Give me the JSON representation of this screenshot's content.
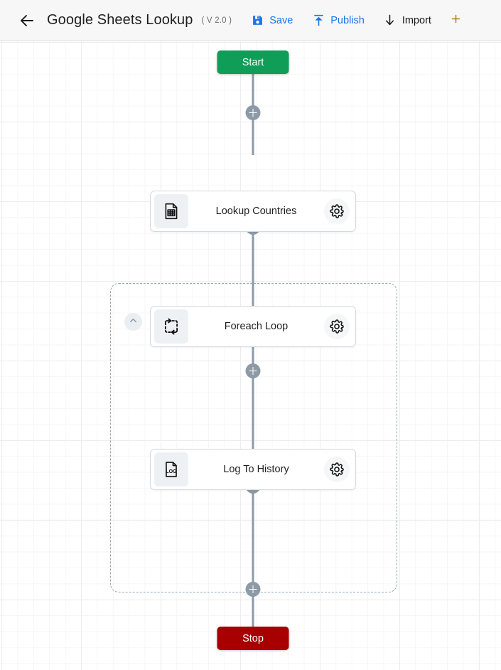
{
  "header": {
    "back_icon": "back-arrow-icon",
    "title": "Google Sheets Lookup",
    "version": "( V 2.0 )",
    "actions": [
      {
        "label": "Save",
        "icon": "save-floppy-icon",
        "style": "primary"
      },
      {
        "label": "Publish",
        "icon": "publish-upload-icon",
        "style": "primary"
      },
      {
        "label": "Import",
        "icon": "import-download-icon",
        "style": "dark"
      }
    ],
    "overflow_action": {
      "label": "",
      "icon": "partial-cut-off-icon"
    }
  },
  "canvas": {
    "start": {
      "label": "Start",
      "color": "#0f9d58"
    },
    "stop": {
      "label": "Stop",
      "color": "#a80000"
    },
    "connector_color": "#8d9aa6",
    "add_buttons": [
      {
        "name": "add-step-after-start",
        "label": "+"
      },
      {
        "name": "add-step-after-lookup",
        "label": "+"
      },
      {
        "name": "add-step-in-loop",
        "label": "+"
      },
      {
        "name": "add-step-after-log",
        "label": "+"
      },
      {
        "name": "add-step-before-stop",
        "label": "+"
      }
    ],
    "nodes": [
      {
        "name": "lookup-countries",
        "label": "Lookup Countries",
        "icon": "spreadsheet-document-icon",
        "gear_icon": "gear-icon"
      },
      {
        "name": "foreach-loop",
        "label": "Foreach Loop",
        "icon": "loop-repeat-icon",
        "gear_icon": "gear-icon",
        "collapse_icon": "chevron-up-icon"
      },
      {
        "name": "log-to-history",
        "label": "Log To History",
        "icon": "log-document-icon",
        "gear_icon": "gear-icon"
      }
    ]
  }
}
